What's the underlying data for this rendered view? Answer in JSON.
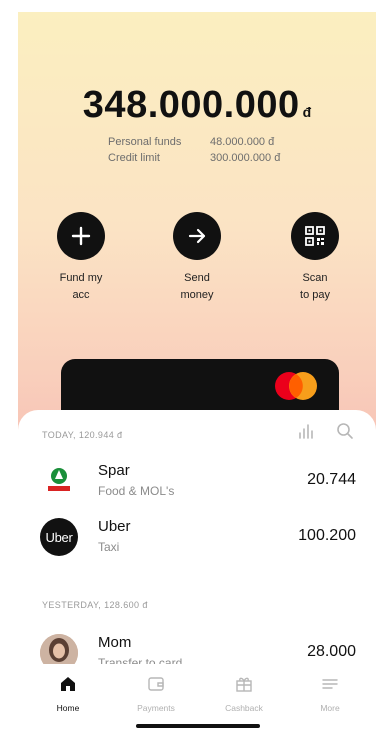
{
  "balance": {
    "amount": "348.000.000",
    "currency": "đ",
    "personal_label": "Personal funds",
    "personal_value": "48.000.000 đ",
    "credit_label": "Credit limit",
    "credit_value": "300.000.000 đ"
  },
  "actions": [
    {
      "label": "Fund my\nacc",
      "icon": "plus-icon"
    },
    {
      "label": "Send\nmoney",
      "icon": "arrow-right-icon"
    },
    {
      "label": "Scan\nto pay",
      "icon": "qr-code-icon"
    }
  ],
  "today": {
    "header": "TODAY, 120.944 đ",
    "items": [
      {
        "name": "Spar",
        "category": "Food & MOL's",
        "amount": "20.744"
      },
      {
        "name": "Uber",
        "category": "Taxi",
        "amount": "100.200",
        "logo_text": "Uber"
      }
    ]
  },
  "yesterday": {
    "header": "YESTERDAY, 128.600 đ",
    "items": [
      {
        "name": "Mom",
        "category": "Transfer to card",
        "amount": "28.000"
      }
    ]
  },
  "nav": {
    "home": "Home",
    "payments": "Payments",
    "cashback": "Cashback",
    "more": "More"
  },
  "colors": {
    "accent": "#111111",
    "mastercard_red": "#eb001b",
    "mastercard_orange": "#f79e1b"
  }
}
